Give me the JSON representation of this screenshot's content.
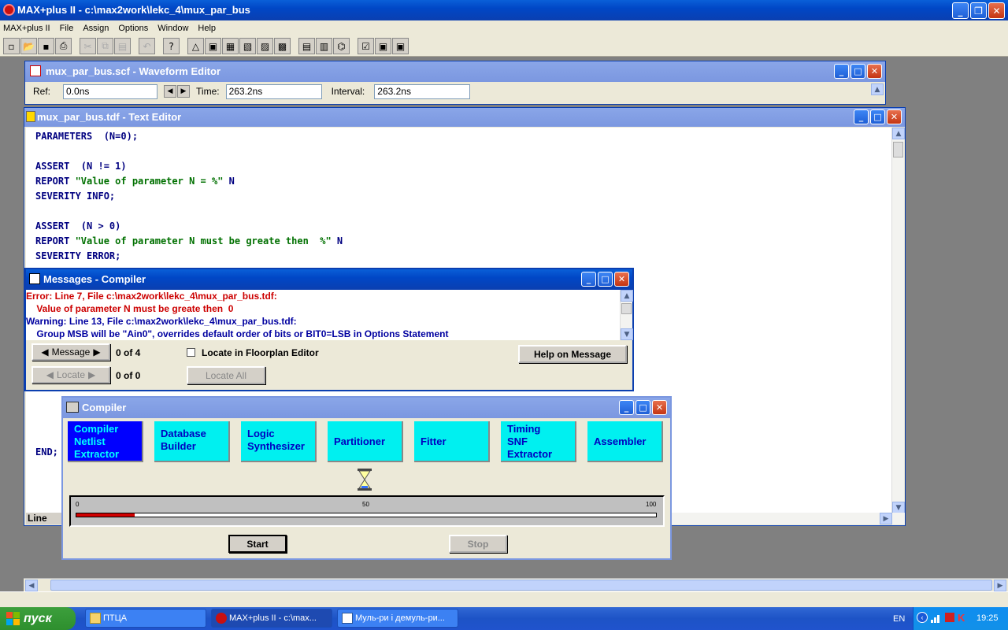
{
  "main_window": {
    "title": "MAX+plus II - c:\\max2work\\lekc_4\\mux_par_bus",
    "menu": [
      "MAX+plus II",
      "File",
      "Assign",
      "Options",
      "Window",
      "Help"
    ]
  },
  "waveform_editor": {
    "title": "mux_par_bus.scf - Waveform Editor",
    "ref_label": "Ref:",
    "ref_value": "0.0ns",
    "time_label": "Time:",
    "time_value": "263.2ns",
    "interval_label": "Interval:",
    "interval_value": "263.2ns"
  },
  "text_editor": {
    "title": "mux_par_bus.tdf - Text Editor",
    "lines": [
      {
        "kw": "PARAMETERS  (N=0);",
        "str": "",
        "tail": ""
      },
      {
        "kw": "",
        "str": "",
        "tail": ""
      },
      {
        "kw": "ASSERT  (N != 1)",
        "str": "",
        "tail": ""
      },
      {
        "kw": "REPORT ",
        "str": "\"Value of parameter N = %\"",
        "tail": " N"
      },
      {
        "kw": "SEVERITY INFO;",
        "str": "",
        "tail": ""
      },
      {
        "kw": "",
        "str": "",
        "tail": ""
      },
      {
        "kw": "ASSERT  (N > 0)",
        "str": "",
        "tail": ""
      },
      {
        "kw": "REPORT ",
        "str": "\"Value of parameter N must be greate then  %\"",
        "tail": " N"
      },
      {
        "kw": "SEVERITY ERROR;",
        "str": "",
        "tail": ""
      }
    ],
    "end_line": "END;",
    "partial_line": "[]    []",
    "status_label": "Line"
  },
  "messages": {
    "title": "Messages - Compiler",
    "items": [
      {
        "type": "error",
        "text": "Error: Line 7, File c:\\max2work\\lekc_4\\mux_par_bus.tdf:"
      },
      {
        "type": "error",
        "text": "    Value of parameter N must be greate then  0"
      },
      {
        "type": "warning",
        "text": "Warning: Line 13, File c:\\max2work\\lekc_4\\mux_par_bus.tdf:"
      },
      {
        "type": "warning",
        "text": "    Group MSB will be \"Ain0\", overrides default order of bits or BIT0=LSB in Options Statement"
      }
    ],
    "message_button": "Message",
    "message_count": "0 of 4",
    "locate_checkbox": "Locate in Floorplan Editor",
    "help_button": "Help on Message",
    "locate_button": "Locate",
    "locate_count": "0 of 0",
    "locate_all_button": "Locate All"
  },
  "compiler": {
    "title": "Compiler",
    "modules": [
      {
        "label": "Compiler\nNetlist\nExtractor",
        "active": true
      },
      {
        "label": "Database\nBuilder",
        "active": false
      },
      {
        "label": "Logic\nSynthesizer",
        "active": false
      },
      {
        "label": "Partitioner",
        "active": false
      },
      {
        "label": "Fitter",
        "active": false
      },
      {
        "label": "Timing\nSNF\nExtractor",
        "active": false
      },
      {
        "label": "Assembler",
        "active": false
      }
    ],
    "progress_percent": 10,
    "progress_ticks": [
      "0",
      "50",
      "100"
    ],
    "start_button": "Start",
    "stop_button": "Stop"
  },
  "taskbar": {
    "start_label": "пуск",
    "tasks": [
      "ПТЦА",
      "MAX+plus II - c:\\max...",
      "Муль-ри і демуль-ри..."
    ],
    "lang": "EN",
    "clock": "19:25"
  }
}
